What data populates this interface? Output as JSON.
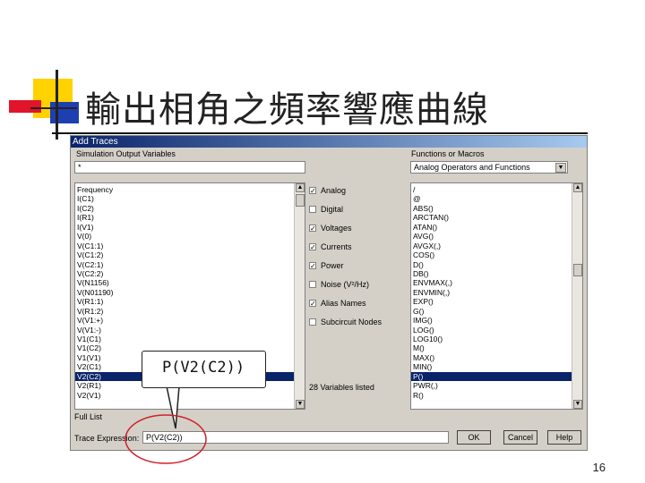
{
  "slide": {
    "title": "輸出相角之頻率響應曲線",
    "page_number": "16"
  },
  "dialog": {
    "title": "Add Traces",
    "sim_vars_label": "Simulation Output Variables",
    "filter_value": "*",
    "variables": [
      "Frequency",
      "I(C1)",
      "I(C2)",
      "I(R1)",
      "I(V1)",
      "V(0)",
      "V(C1:1)",
      "V(C1:2)",
      "V(C2:1)",
      "V(C2:2)",
      "V(N1156)",
      "V(N01190)",
      "V(R1:1)",
      "V(R1:2)",
      "V(V1:+)",
      "V(V1:-)",
      "V1(C1)",
      "V1(C2)",
      "V1(V1)",
      "V2(C1)",
      "V2(C2)",
      "V2(R1)",
      "V2(V1)"
    ],
    "selected_variable": "V2(C2)",
    "checkboxes": [
      {
        "label": "Analog",
        "checked": true
      },
      {
        "label": "Digital",
        "checked": false
      },
      {
        "label": "Voltages",
        "checked": true
      },
      {
        "label": "Currents",
        "checked": true
      },
      {
        "label": "Power",
        "checked": true
      },
      {
        "label": "Noise (V²/Hz)",
        "checked": false
      },
      {
        "label": "Alias Names",
        "checked": true
      },
      {
        "label": "Subcircuit Nodes",
        "checked": false
      }
    ],
    "variables_count": "28 Variables listed",
    "functions_label": "Functions or Macros",
    "functions_dropdown": "Analog Operators and Functions",
    "functions": [
      "/",
      "@",
      "ABS()",
      "ARCTAN()",
      "ATAN()",
      "AVG()",
      "AVGX(,)",
      "COS()",
      "D()",
      "DB()",
      "ENVMAX(,)",
      "ENVMIN(,)",
      "EXP()",
      "G()",
      "IMG()",
      "LOG()",
      "LOG10()",
      "M()",
      "MAX()",
      "MIN()",
      "P()",
      "PWR(,)",
      "R()"
    ],
    "selected_function": "P()",
    "full_list_label": "Full List",
    "trace_expression_label": "Trace Expression:",
    "trace_expression_value": "P(V2(C2))",
    "buttons": {
      "ok": "OK",
      "cancel": "Cancel",
      "help": "Help"
    }
  },
  "callout": {
    "text": "P(V2(C2))"
  },
  "colors": {
    "titlebar": "#0a246a",
    "selection": "#0a246a",
    "callout_circle": "#d0202a"
  }
}
